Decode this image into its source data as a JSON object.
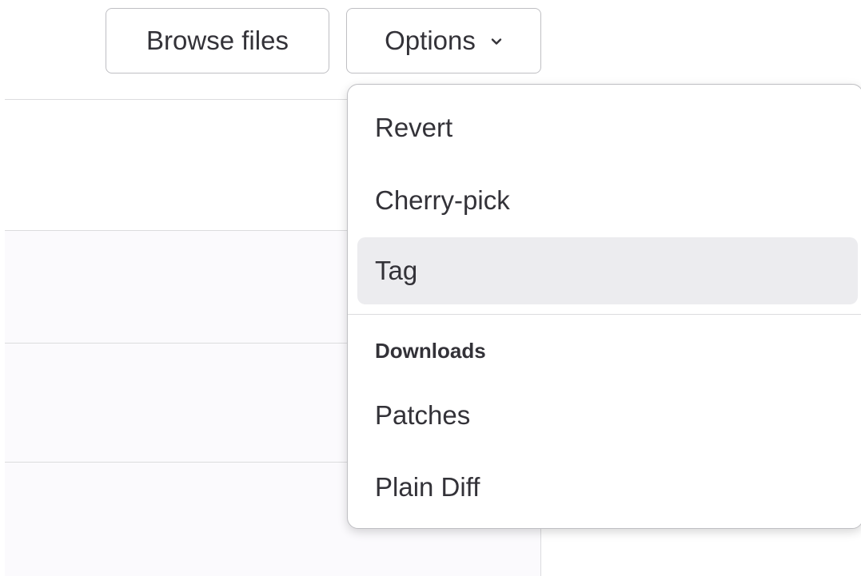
{
  "header": {
    "browse_label": "Browse files",
    "options_label": "Options"
  },
  "icons": {
    "options_chevron": "chevron-down-icon"
  },
  "dropdown": {
    "items": [
      {
        "label": "Revert"
      },
      {
        "label": "Cherry-pick"
      },
      {
        "label": "Tag",
        "highlighted": true
      }
    ],
    "downloads_heading": "Downloads",
    "download_items": [
      {
        "label": "Patches"
      },
      {
        "label": "Plain Diff"
      }
    ]
  },
  "colors": {
    "text": "#333238",
    "border": "#bfbfc3",
    "highlight": "#ececef",
    "row_background": "#fbfafd"
  }
}
